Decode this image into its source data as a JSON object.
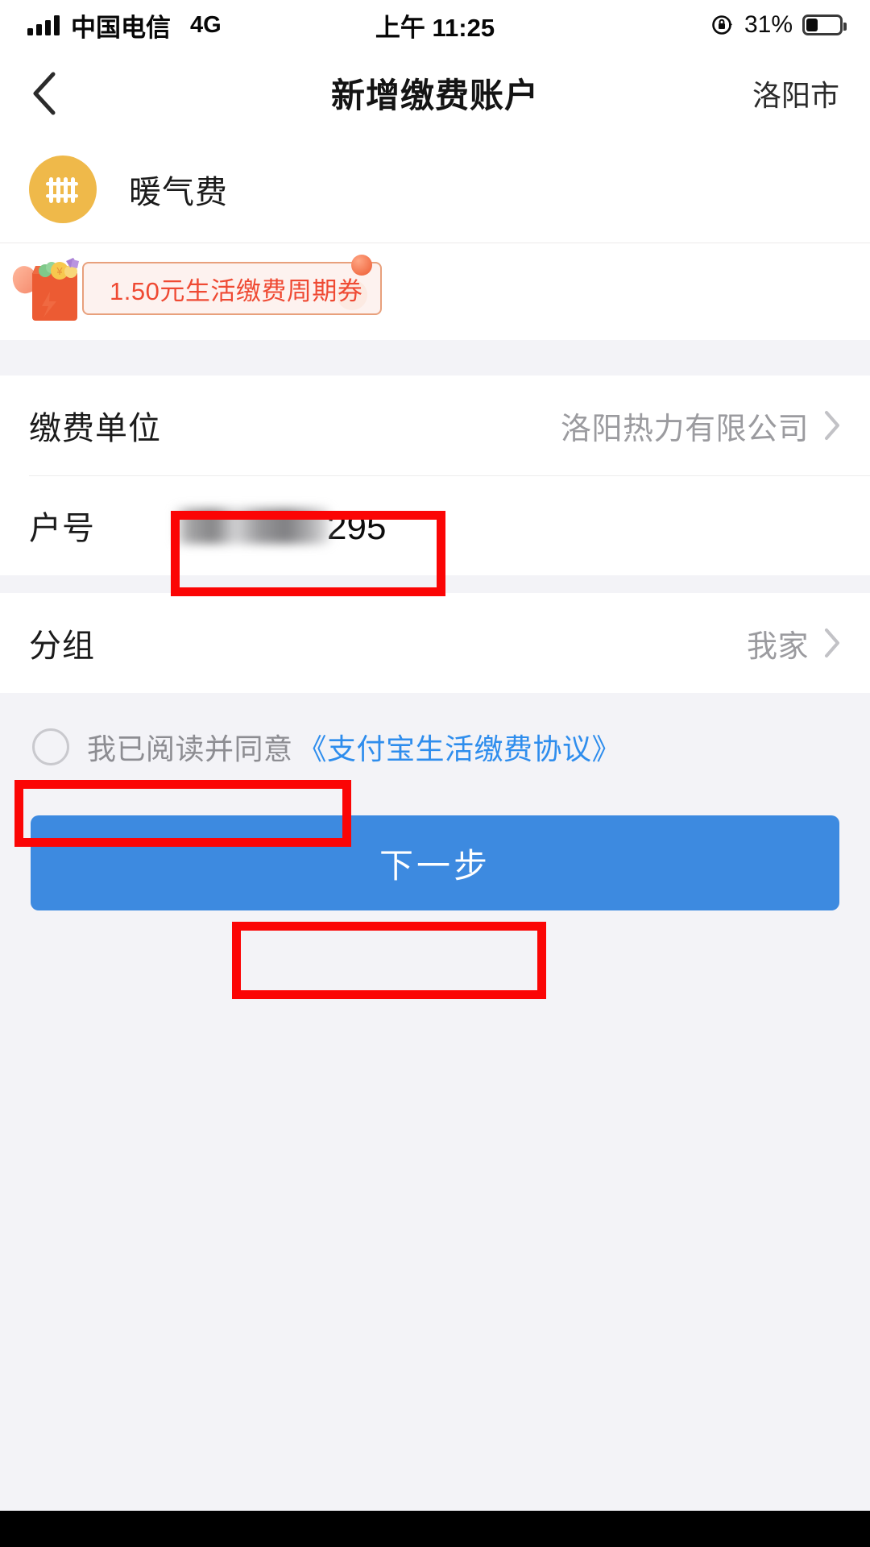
{
  "status_bar": {
    "carrier": "中国电信",
    "network": "4G",
    "time": "上午 11:25",
    "battery_percent": "31%",
    "battery_level": 31,
    "signal_bars": 4,
    "rotation_lock_icon": "rotation-lock-icon"
  },
  "nav": {
    "back_icon": "chevron-left-icon",
    "title": "新增缴费账户",
    "city": "洛阳市"
  },
  "service": {
    "icon": "radiator-icon",
    "icon_color": "#efb94a",
    "name": "暖气费"
  },
  "coupon": {
    "icon": "gift-bag-icon",
    "text": "1.50元生活缴费周期券",
    "text_color": "#ef4a33",
    "card_bg": "#fdf2ef",
    "card_border": "#e8a07c"
  },
  "form": {
    "rows": [
      {
        "label": "缴费单位",
        "value": "洛阳热力有限公司",
        "chevron_icon": "chevron-right-icon"
      },
      {
        "label": "分组",
        "value": "我家",
        "chevron_icon": "chevron-right-icon"
      }
    ],
    "account_row": {
      "label": "户号",
      "value_masked": "",
      "value_visible": "295"
    }
  },
  "agreement": {
    "checkbox_icon": "radio-unchecked-icon",
    "checked": false,
    "text": "我已阅读并同意",
    "link_text": "《支付宝生活缴费协议》",
    "link_color": "#2e8ded"
  },
  "primary_action": {
    "label": "下一步",
    "color": "#3d8ae0"
  },
  "annotations": {
    "color": "#fb0505",
    "boxes": [
      {
        "name": "account-number-field",
        "target": "户号"
      },
      {
        "name": "agreement-checkbox",
        "target": "我已阅读并同意"
      },
      {
        "name": "next-step-button",
        "target": "下一步"
      }
    ]
  }
}
